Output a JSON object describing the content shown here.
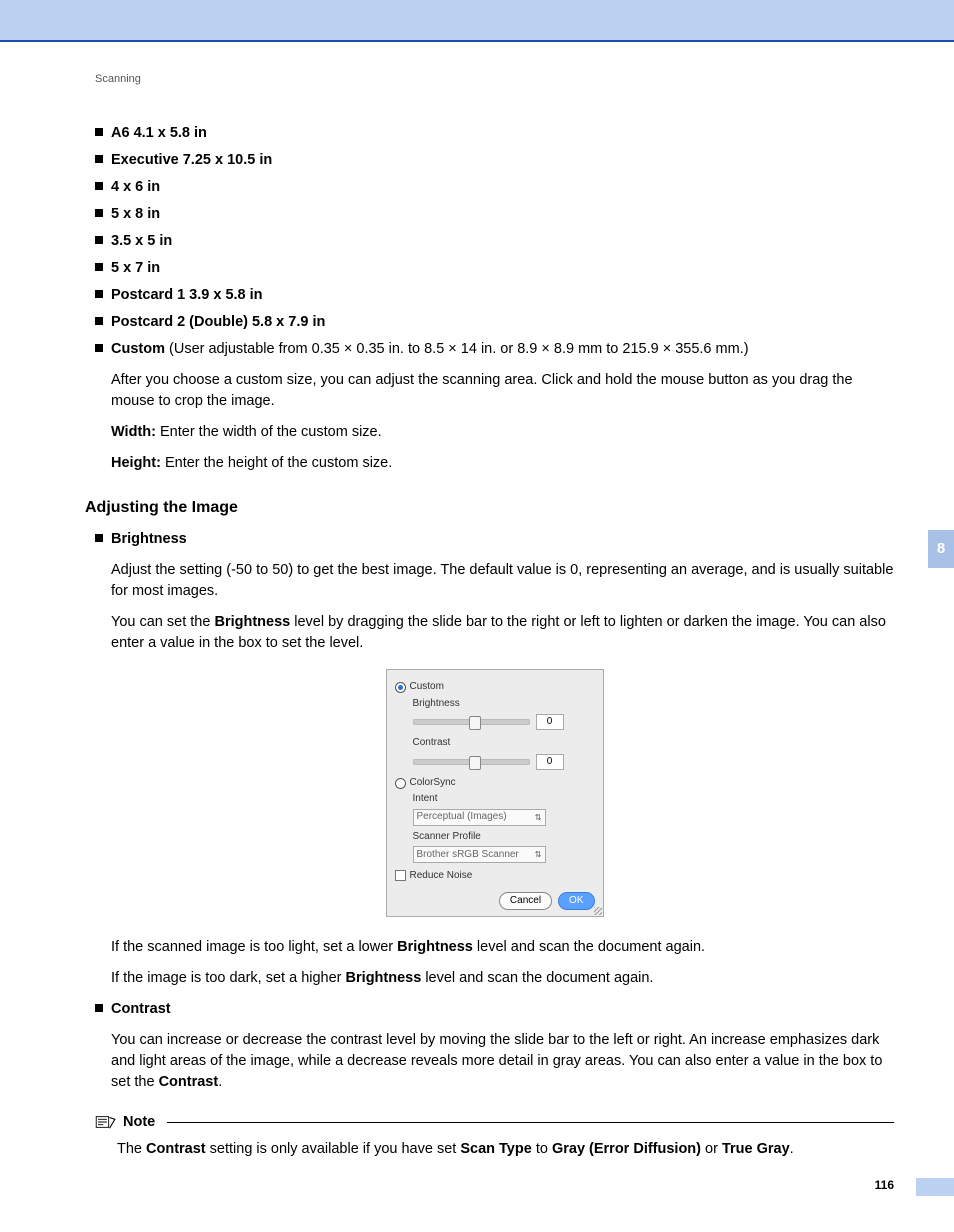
{
  "header": {
    "section": "Scanning"
  },
  "sizes": [
    "A6 4.1 x 5.8 in",
    "Executive 7.25 x 10.5 in",
    "4 x 6 in",
    "5 x 8 in",
    "3.5 x 5 in",
    "5 x 7 in",
    "Postcard 1 3.9 x 5.8 in",
    "Postcard 2 (Double) 5.8 x 7.9 in"
  ],
  "custom": {
    "lead": "Custom",
    "rest": " (User adjustable from 0.35 × 0.35 in. to 8.5 × 14 in. or 8.9 × 8.9 mm to 215.9 × 355.6 mm.)",
    "para": "After you choose a custom size, you can adjust the scanning area. Click and hold the mouse button as you drag the mouse to crop the image.",
    "width_lead": "Width:",
    "width_rest": " Enter the width of the custom size.",
    "height_lead": "Height:",
    "height_rest": " Enter the height of the custom size."
  },
  "adjust": {
    "title": "Adjusting the Image",
    "brightness": {
      "label": "Brightness",
      "p1": "Adjust the setting (-50 to 50) to get the best image. The default value is 0, representing an average, and is usually suitable for most images.",
      "p2a": "You can set the ",
      "p2b": "Brightness",
      "p2c": " level by dragging the slide bar to the right or left to lighten or darken the image. You can also enter a value in the box to set the level.",
      "p3a": "If the scanned image is too light, set a lower ",
      "p3b": "Brightness",
      "p3c": " level and scan the document again.",
      "p4a": "If the image is too dark, set a higher ",
      "p4b": "Brightness",
      "p4c": " level and scan the document again."
    },
    "contrast": {
      "label": "Contrast",
      "p1a": "You can increase or decrease the contrast level by moving the slide bar to the left or right. An increase emphasizes dark and light areas of the image, while a decrease reveals more detail in gray areas. You can also enter a value in the box to set the ",
      "p1b": "Contrast",
      "p1c": "."
    }
  },
  "dialog": {
    "custom": "Custom",
    "brightness": "Brightness",
    "brightness_val": "0",
    "contrast": "Contrast",
    "contrast_val": "0",
    "colorsync": "ColorSync",
    "intent": "Intent",
    "intent_val": "Perceptual (Images)",
    "profile": "Scanner Profile",
    "profile_val": "Brother sRGB Scanner",
    "reduce": "Reduce Noise",
    "cancel": "Cancel",
    "ok": "OK"
  },
  "note": {
    "title": "Note",
    "a": "The ",
    "b": "Contrast",
    "c": " setting is only available if you have set ",
    "d": "Scan Type",
    "e": " to ",
    "f": "Gray (Error Diffusion)",
    "g": " or ",
    "h": "True Gray",
    "i": "."
  },
  "tab": "8",
  "page": "116"
}
